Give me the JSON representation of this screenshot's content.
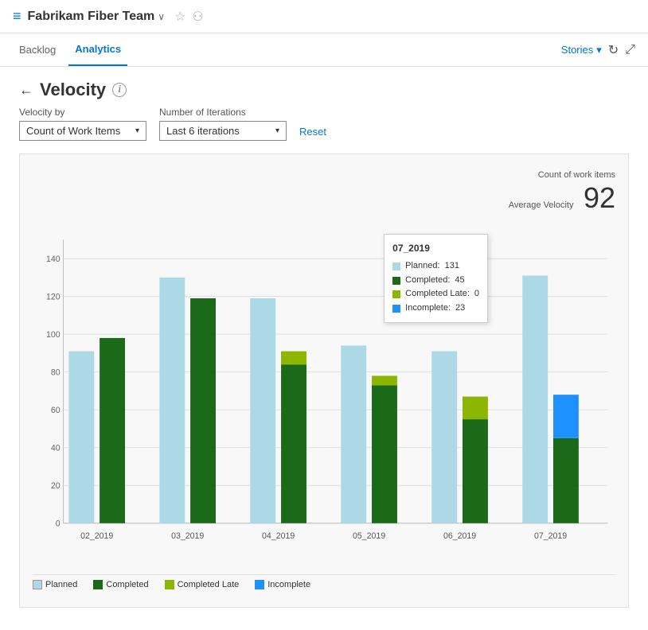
{
  "header": {
    "icon": "≡",
    "title": "Fabrikam Fiber Team",
    "chevron": "∨",
    "star_label": "☆",
    "team_icon": "⚇"
  },
  "nav": {
    "backlog_label": "Backlog",
    "analytics_label": "Analytics",
    "stories_label": "Stories",
    "refresh_label": "↻",
    "expand_label": "⤢"
  },
  "page": {
    "back_label": "←",
    "title": "Velocity",
    "help_label": "i"
  },
  "filters": {
    "velocity_by_label": "Velocity by",
    "velocity_by_value": "Count of Work Items",
    "iterations_label": "Number of Iterations",
    "iterations_value": "Last 6 iterations",
    "reset_label": "Reset"
  },
  "chart": {
    "meta_label": "Count of work items",
    "meta_sublabel": "Average Velocity",
    "meta_value": "92",
    "y_ticks": [
      0,
      20,
      40,
      60,
      80,
      100,
      120,
      140
    ],
    "bars": [
      {
        "label": "02_2019",
        "planned": 91,
        "completed": 98,
        "completed_late": 0,
        "incomplete": 0
      },
      {
        "label": "03_2019",
        "planned": 130,
        "completed": 119,
        "completed_late": 0,
        "incomplete": 0
      },
      {
        "label": "04_2019",
        "planned": 119,
        "completed": 84,
        "completed_late": 7,
        "incomplete": 0
      },
      {
        "label": "05_2019",
        "planned": 94,
        "completed": 73,
        "completed_late": 5,
        "incomplete": 0
      },
      {
        "label": "06_2019",
        "planned": 91,
        "completed": 55,
        "completed_late": 12,
        "incomplete": 0
      },
      {
        "label": "07_2019",
        "planned": 131,
        "completed": 45,
        "completed_late": 0,
        "incomplete": 23
      }
    ],
    "tooltip": {
      "title": "07_2019",
      "planned_label": "Planned:",
      "planned_value": "131",
      "completed_label": "Completed:",
      "completed_value": "45",
      "completed_late_label": "Completed Late:",
      "completed_late_value": "0",
      "incomplete_label": "Incomplete:",
      "incomplete_value": "23"
    },
    "legend": {
      "planned": "Planned",
      "completed": "Completed",
      "completed_late": "Completed Late",
      "incomplete": "Incomplete"
    },
    "colors": {
      "planned": "#add8e6",
      "completed": "#1a6a1a",
      "completed_late": "#8db600",
      "incomplete": "#1e90ff"
    }
  }
}
